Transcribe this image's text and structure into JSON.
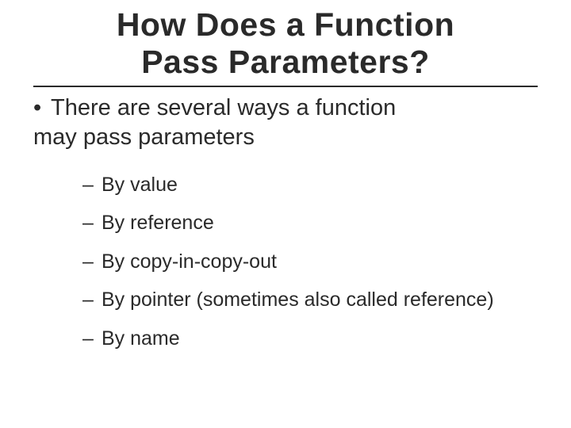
{
  "title_line1": "How Does a Function",
  "title_line2": "Pass Parameters?",
  "bullet": {
    "marker": "•",
    "text_line1": "There are several ways a function",
    "text_line2": "may pass parameters"
  },
  "sub_marker": "–",
  "subitems": [
    "By value",
    "By reference",
    "By copy-in-copy-out",
    "By pointer (sometimes also called reference)",
    "By name"
  ]
}
